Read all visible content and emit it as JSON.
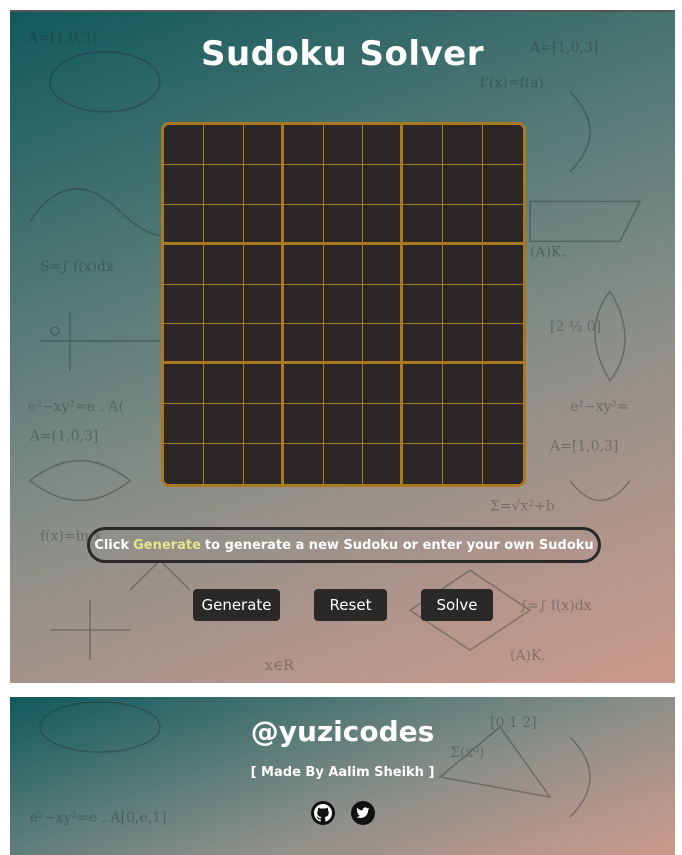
{
  "app": {
    "title": "Sudoku Solver"
  },
  "board": {
    "rows": 9,
    "cols": 9,
    "values": [
      [
        "",
        "",
        "",
        "",
        "",
        "",
        "",
        "",
        ""
      ],
      [
        "",
        "",
        "",
        "",
        "",
        "",
        "",
        "",
        ""
      ],
      [
        "",
        "",
        "",
        "",
        "",
        "",
        "",
        "",
        ""
      ],
      [
        "",
        "",
        "",
        "",
        "",
        "",
        "",
        "",
        ""
      ],
      [
        "",
        "",
        "",
        "",
        "",
        "",
        "",
        "",
        ""
      ],
      [
        "",
        "",
        "",
        "",
        "",
        "",
        "",
        "",
        ""
      ],
      [
        "",
        "",
        "",
        "",
        "",
        "",
        "",
        "",
        ""
      ],
      [
        "",
        "",
        "",
        "",
        "",
        "",
        "",
        "",
        ""
      ],
      [
        "",
        "",
        "",
        "",
        "",
        "",
        "",
        "",
        ""
      ]
    ]
  },
  "instruction": {
    "prefix": "Click",
    "highlight": "Generate",
    "suffix": "to generate a new Sudoku or enter your own Sudoku"
  },
  "buttons": {
    "generate_label": "Generate",
    "reset_label": "Reset",
    "solve_label": "Solve"
  },
  "footer": {
    "handle": "@yuzicodes",
    "credit": "[ Made By Aalim Sheikh ]",
    "icons": [
      "github-icon",
      "twitter-icon"
    ]
  },
  "colors": {
    "board_bg": "#2b2727",
    "board_border": "#a9781f",
    "highlight": "#e6e58a",
    "button_bg": "#2b2828"
  }
}
